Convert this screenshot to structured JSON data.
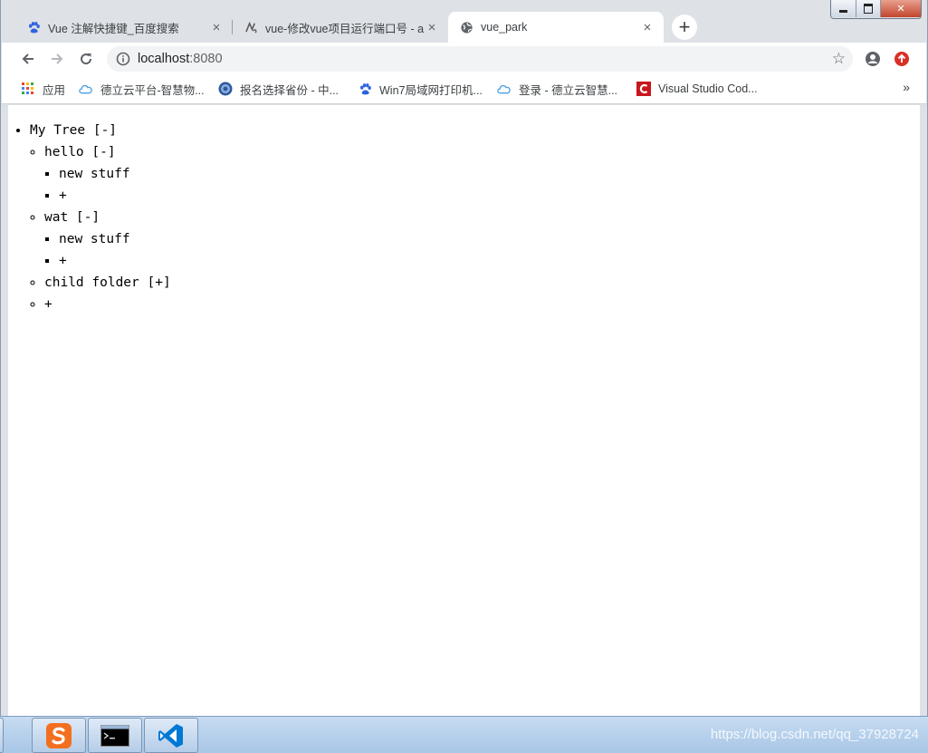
{
  "browser": {
    "tabs": [
      {
        "title": "Vue 注解快捷键_百度搜索",
        "icon": "baidu-paw-icon",
        "active": false
      },
      {
        "title": "vue-修改vue项目运行端口号 - a",
        "icon": "site-logo-icon",
        "active": false
      },
      {
        "title": "vue_park",
        "icon": "globe-icon",
        "active": true
      }
    ],
    "new_tab_label": "+",
    "close_label": "×",
    "address": {
      "host": "localhost",
      "port": ":8080"
    },
    "bookmarks": [
      {
        "label": "应用",
        "icon": "apps-grid-icon"
      },
      {
        "label": "德立云平台-智慧物...",
        "icon": "cloud-icon"
      },
      {
        "label": "报名选择省份 - 中...",
        "icon": "seal-icon"
      },
      {
        "label": "Win7局域网打印机...",
        "icon": "baidu-paw-icon"
      },
      {
        "label": "登录 - 德立云智慧...",
        "icon": "cloud-icon"
      },
      {
        "label": "Visual Studio Cod...",
        "icon": "csdn-icon"
      }
    ],
    "bookmarks_overflow": "»",
    "accent_colors": {
      "update_button": "#d93025",
      "baidu_blue": "#2d62e0",
      "cloud_blue": "#4a9fe0"
    }
  },
  "page": {
    "tree": {
      "root": "My Tree [-]",
      "children": [
        {
          "label": "hello [-]",
          "children": [
            "new stuff",
            "+"
          ]
        },
        {
          "label": "wat [-]",
          "children": [
            "new stuff",
            "+"
          ]
        },
        {
          "label": "child folder [+]"
        },
        {
          "label": "+"
        }
      ]
    }
  },
  "taskbar": {
    "items": [
      {
        "name": "sogou-input-icon"
      },
      {
        "name": "command-prompt-icon"
      },
      {
        "name": "vscode-icon"
      }
    ],
    "watermark": "https://blog.csdn.net/qq_37928724"
  }
}
